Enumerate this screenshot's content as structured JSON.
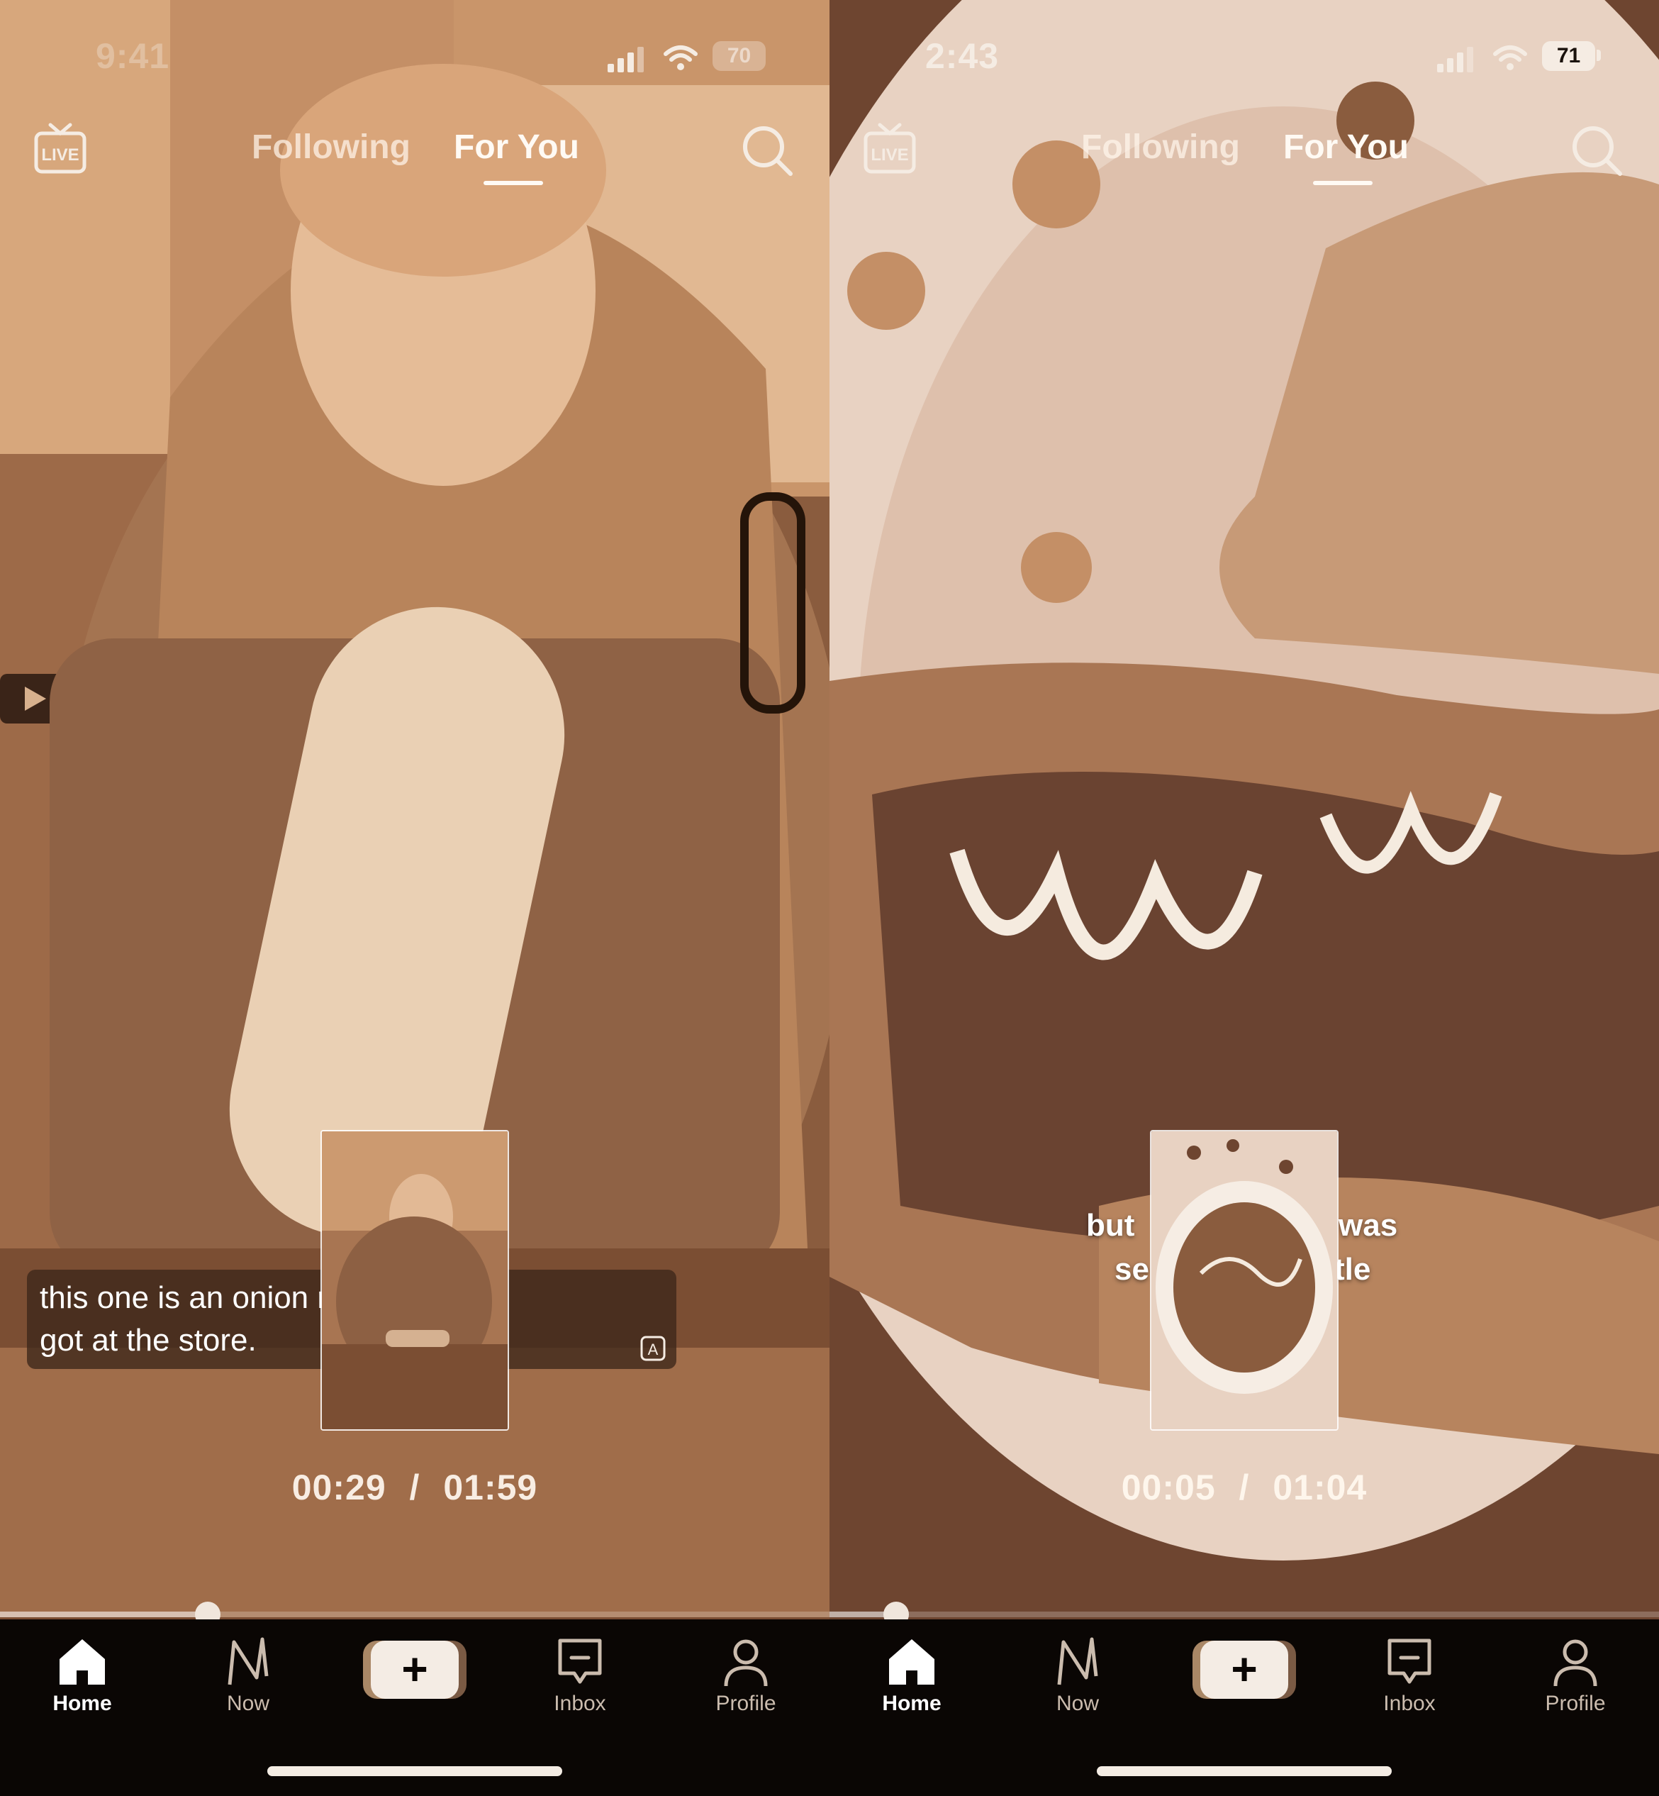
{
  "screens": [
    {
      "status": {
        "time": "9:41",
        "battery": "70"
      },
      "tabs": {
        "following": "Following",
        "for_you": "For You"
      },
      "caption": {
        "line1": "this one is an onion roll that I",
        "line2": "got at the store."
      },
      "timecode": {
        "current": "00:29",
        "separator": "/",
        "total": "01:59"
      },
      "progress": 0.25
    },
    {
      "status": {
        "time": "2:43",
        "battery": "71"
      },
      "tabs": {
        "following": "Following",
        "for_you": "For You"
      },
      "caption": {
        "left1": "but",
        "right1": "was",
        "left2": "se",
        "right2": "tle"
      },
      "timecode": {
        "current": "00:05",
        "separator": "/",
        "total": "01:04"
      },
      "progress": 0.08
    }
  ],
  "bottom_nav": {
    "home": "Home",
    "now": "Now",
    "create": "+",
    "inbox": "Inbox",
    "profile": "Profile"
  },
  "colors": {
    "tint": "#c8956b",
    "nav_bg": "#0a0604",
    "text": "#fffaf4"
  }
}
